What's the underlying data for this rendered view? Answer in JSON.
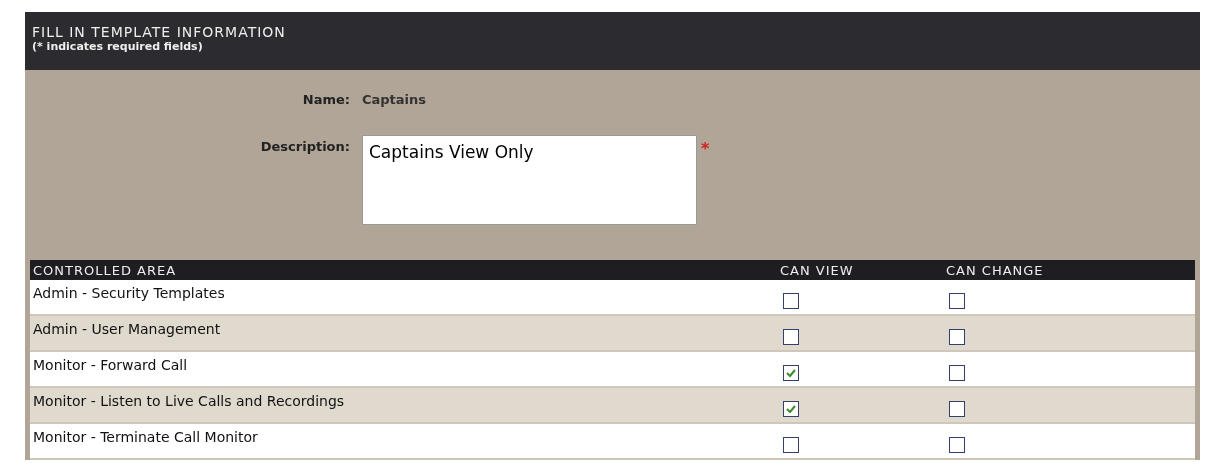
{
  "header": {
    "title": "FILL IN TEMPLATE INFORMATION",
    "subtitle": "(* indicates required fields)"
  },
  "form": {
    "name_label": "Name:",
    "name_value": "Captains",
    "description_label": "Description:",
    "description_value": "Captains View Only",
    "required_mark": "*"
  },
  "table": {
    "columns": [
      "CONTROLLED AREA",
      "CAN VIEW",
      "CAN CHANGE"
    ],
    "rows": [
      {
        "area": "Admin - Security Templates",
        "can_view": false,
        "can_change": false
      },
      {
        "area": "Admin - User Management",
        "can_view": false,
        "can_change": false
      },
      {
        "area": "Monitor - Forward Call",
        "can_view": true,
        "can_change": false
      },
      {
        "area": "Monitor - Listen to Live Calls and Recordings",
        "can_view": true,
        "can_change": false
      },
      {
        "area": "Monitor - Terminate Call Monitor",
        "can_view": false,
        "can_change": false
      }
    ]
  }
}
